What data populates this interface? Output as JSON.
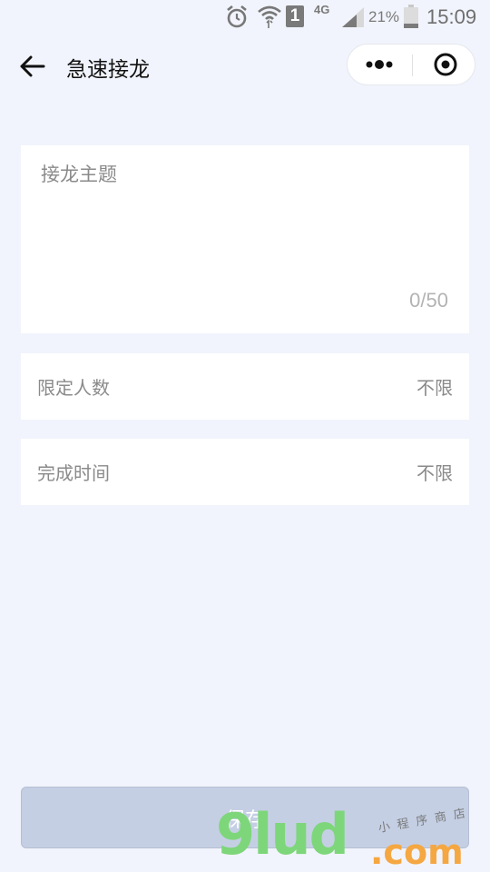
{
  "status_bar": {
    "sim": "1",
    "network": "4G",
    "battery": "21%",
    "time": "15:09",
    "icons": [
      "alarm-icon",
      "wifi-icon",
      "sim-icon",
      "signal-icon",
      "battery-icon"
    ]
  },
  "navbar": {
    "title": "急速接龙",
    "back_icon": "back-arrow-icon",
    "more_icon": "more-dots-icon",
    "close_icon": "record-circle-icon"
  },
  "form": {
    "topic": {
      "placeholder": "接龙主题",
      "value": "",
      "counter": "0/50"
    },
    "limit": {
      "label": "限定人数",
      "value": "不限"
    },
    "deadline": {
      "label": "完成时间",
      "value": "不限"
    }
  },
  "save_button": {
    "label": "保存"
  },
  "watermark": {
    "logo_text": "9lud",
    "domain": ".com",
    "tagline": "小程序商店"
  },
  "colors": {
    "page_bg": "#f1f4fc",
    "card_bg": "#ffffff",
    "button_bg": "#c4cfe4",
    "muted_text": "#8a8a8a"
  }
}
